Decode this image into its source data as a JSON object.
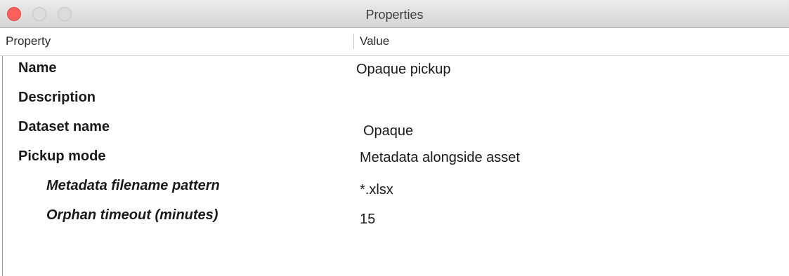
{
  "window": {
    "title": "Properties"
  },
  "table": {
    "columns": {
      "property": "Property",
      "value": "Value"
    },
    "rows": [
      {
        "label": "Name",
        "value": "Opaque pickup",
        "level": 0
      },
      {
        "label": "Description",
        "value": "",
        "level": 0
      },
      {
        "label": "Dataset name",
        "value": "Opaque",
        "level": 0
      },
      {
        "label": "Pickup mode",
        "value": "Metadata alongside asset",
        "level": 0
      },
      {
        "label": "Metadata filename pattern",
        "value": "*.xlsx",
        "level": 1
      },
      {
        "label": "Orphan timeout (minutes)",
        "value": "15",
        "level": 1
      }
    ]
  }
}
